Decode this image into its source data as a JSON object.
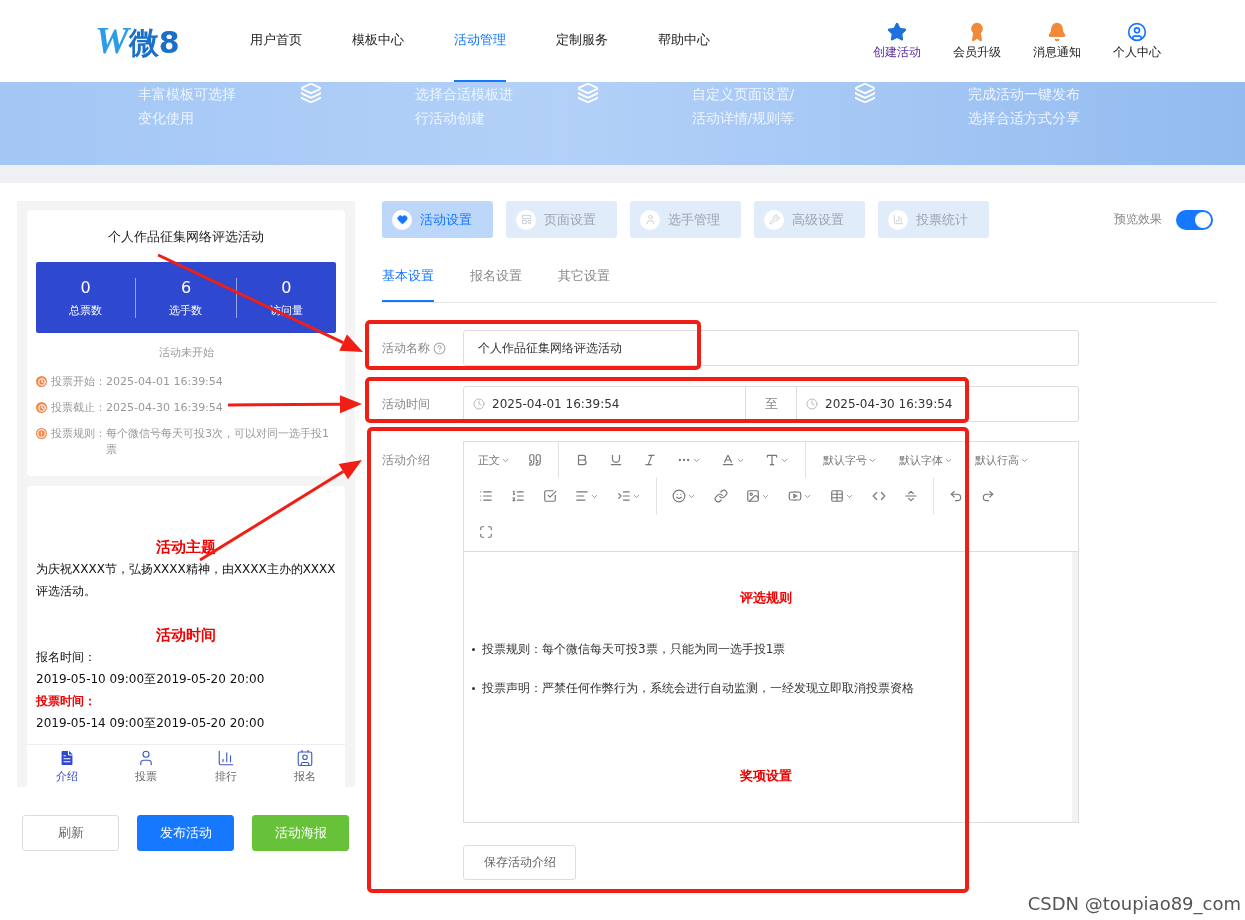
{
  "header": {
    "logo": {
      "mark": "W",
      "text": "微8"
    },
    "nav": [
      {
        "label": "用户首页",
        "selected": false
      },
      {
        "label": "模板中心",
        "selected": false
      },
      {
        "label": "活动管理",
        "selected": true
      },
      {
        "label": "定制服务",
        "selected": false
      },
      {
        "label": "帮助中心",
        "selected": false
      }
    ],
    "actions": [
      {
        "kind": "star",
        "label": "创建活动"
      },
      {
        "kind": "vip",
        "label": "会员升级"
      },
      {
        "kind": "bell",
        "label": "消息通知"
      },
      {
        "kind": "user",
        "label": "个人中心"
      }
    ]
  },
  "banner": {
    "steps": [
      {
        "lines": [
          "丰富模板可选择",
          "变化使用"
        ]
      },
      {
        "lines": [
          "选择合适模板进",
          "行活动创建"
        ]
      },
      {
        "lines": [
          "自定义页面设置/",
          "活动详情/规则等"
        ]
      },
      {
        "lines": [
          "完成活动一键发布",
          "选择合适方式分享"
        ]
      }
    ]
  },
  "preview": {
    "title": "个人作品征集网络评选活动",
    "stats": [
      {
        "value": "0",
        "label": "总票数"
      },
      {
        "value": "6",
        "label": "选手数"
      },
      {
        "value": "0",
        "label": "访问量"
      }
    ],
    "status": "活动未开始",
    "info": [
      {
        "kind": "clock",
        "label": "投票开始：",
        "value": "2025-04-01 16:39:54"
      },
      {
        "kind": "clock",
        "label": "投票截止：",
        "value": "2025-04-30 16:39:54"
      },
      {
        "kind": "alert",
        "label": "投票规则：",
        "value": "每个微信号每天可投3次，可以对同一选手投1票"
      }
    ],
    "content": [
      {
        "kind": "heading",
        "text": "活动主题"
      },
      {
        "kind": "text",
        "text": "为庆祝XXXX节，弘扬XXXX精神，由XXXX主办的XXXX评选活动。"
      },
      {
        "kind": "gap"
      },
      {
        "kind": "heading",
        "text": "活动时间"
      },
      {
        "kind": "text",
        "text": "报名时间："
      },
      {
        "kind": "text",
        "text": "2019-05-10 09:00至2019-05-20 20:00"
      },
      {
        "kind": "label",
        "text": "投票时间："
      },
      {
        "kind": "text",
        "text": "2019-05-14 09:00至2019-05-20 20:00"
      }
    ],
    "tabbar": [
      {
        "kind": "doc",
        "label": "介绍",
        "selected": true
      },
      {
        "kind": "person",
        "label": "投票",
        "selected": false
      },
      {
        "kind": "rank",
        "label": "排行",
        "selected": false
      },
      {
        "kind": "card",
        "label": "报名",
        "selected": false
      }
    ],
    "buttons": [
      {
        "kind": "plain",
        "label": "刷新"
      },
      {
        "kind": "primary",
        "label": "发布活动"
      },
      {
        "kind": "success",
        "label": "活动海报"
      }
    ]
  },
  "settings": {
    "tabs": [
      {
        "kind": "heart",
        "label": "活动设置",
        "selected": true
      },
      {
        "kind": "page",
        "label": "页面设置",
        "selected": false
      },
      {
        "kind": "person",
        "label": "选手管理",
        "selected": false
      },
      {
        "kind": "tools",
        "label": "高级设置",
        "selected": false
      },
      {
        "kind": "chart",
        "label": "投票统计",
        "selected": false
      }
    ],
    "preview_toggle": {
      "label": "预览效果",
      "on": true
    },
    "subtabs": [
      {
        "label": "基本设置",
        "selected": true
      },
      {
        "label": "报名设置",
        "selected": false
      },
      {
        "label": "其它设置",
        "selected": false
      }
    ],
    "name": {
      "label": "活动名称",
      "value": "个人作品征集网络评选活动"
    },
    "time": {
      "label": "活动时间",
      "start": "2025-04-01 16:39:54",
      "separator": "至",
      "end": "2025-04-30 16:39:54"
    },
    "intro": {
      "label": "活动介绍",
      "toolbar": [
        [
          {
            "kind": "dropdown",
            "label": "正文"
          },
          {
            "kind": "quote"
          },
          {
            "kind": "divider"
          },
          {
            "kind": "bold"
          },
          {
            "kind": "underline"
          },
          {
            "kind": "italic"
          },
          {
            "kind": "more"
          },
          {
            "kind": "fontcolor"
          },
          {
            "kind": "bgcolor"
          },
          {
            "kind": "divider"
          },
          {
            "kind": "dropdown",
            "label": "默认字号"
          },
          {
            "kind": "dropdown",
            "label": "默认字体"
          },
          {
            "kind": "dropdown",
            "label": "默认行高"
          }
        ],
        [
          {
            "kind": "bullets"
          },
          {
            "kind": "numbers"
          },
          {
            "kind": "todo"
          },
          {
            "kind": "align"
          },
          {
            "kind": "indent"
          },
          {
            "kind": "divider"
          },
          {
            "kind": "emoji"
          },
          {
            "kind": "link"
          },
          {
            "kind": "image"
          },
          {
            "kind": "video"
          },
          {
            "kind": "table"
          },
          {
            "kind": "code"
          },
          {
            "kind": "rule"
          },
          {
            "kind": "divider"
          },
          {
            "kind": "undo"
          },
          {
            "kind": "redo"
          }
        ],
        [
          {
            "kind": "fullscreen"
          }
        ]
      ],
      "content": [
        {
          "kind": "heading",
          "text": "评选规则"
        },
        {
          "kind": "bullet",
          "text": "投票规则：每个微信每天可投3票，只能为同一选手投1票"
        },
        {
          "kind": "bullet",
          "text": "投票声明：严禁任何作弊行为，系统会进行自动监测，一经发现立即取消投票资格"
        },
        {
          "kind": "heading",
          "text": "奖项设置"
        }
      ],
      "save": "保存活动介绍"
    }
  },
  "watermark_credit": "CSDN @toupiao89_com"
}
